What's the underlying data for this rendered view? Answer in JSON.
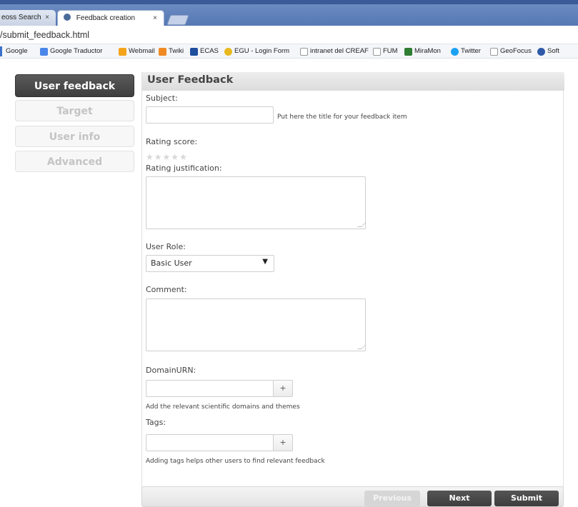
{
  "browser": {
    "tabs": [
      {
        "label": "eoss Search",
        "close": "×"
      },
      {
        "label": "Feedback creation",
        "close": "×"
      }
    ],
    "url": "/submit_feedback.html",
    "bookmarks": [
      {
        "label": "Google",
        "icon": "google-icon",
        "color": "#4285f4"
      },
      {
        "label": "Google Traductor",
        "icon": "translate-icon",
        "color": "#4a86e8"
      },
      {
        "label": "Webmail",
        "icon": "mail-icon",
        "color": "#f4a41c"
      },
      {
        "label": "Twiki",
        "icon": "twiki-icon",
        "color": "#f08a24"
      },
      {
        "label": "ECAS",
        "icon": "ecas-icon",
        "color": "#1f4e9e"
      },
      {
        "label": "EGU - Login Form",
        "icon": "egu-icon",
        "color": "#e8b820"
      },
      {
        "label": "intranet del CREAF",
        "icon": "page-icon",
        "color": "#ffffff"
      },
      {
        "label": "FUM",
        "icon": "page-icon",
        "color": "#ffffff"
      },
      {
        "label": "MiraMon",
        "icon": "miramon-icon",
        "color": "#2e7d32"
      },
      {
        "label": "Twitter",
        "icon": "twitter-icon",
        "color": "#1da1f2"
      },
      {
        "label": "GeoFocus",
        "icon": "page-icon",
        "color": "#ffffff"
      },
      {
        "label": "Soft",
        "icon": "soft-icon",
        "color": "#2e5aa8"
      }
    ]
  },
  "nav": {
    "user_feedback": "User feedback",
    "target": "Target",
    "user_info": "User info",
    "advanced": "Advanced"
  },
  "panel": {
    "title": "User Feedback",
    "subject_label": "Subject:",
    "subject_value": "",
    "subject_hint": "Put here the title for your feedback item",
    "rating_label": "Rating score:",
    "rating_value": 0,
    "rating_max": 5,
    "justification_label": "Rating justification:",
    "role_label": "User Role:",
    "role_value": "Basic User",
    "comment_label": "Comment:",
    "domain_label": "DomainURN:",
    "domain_hint": "Add the relevant scientific domains and themes",
    "tags_label": "Tags:",
    "tags_hint": "Adding tags helps other users to find relevant feedback",
    "plus": "+"
  },
  "footer": {
    "previous": "Previous",
    "next": "Next",
    "submit": "Submit"
  },
  "colors": {
    "tab_strip": "#5577b3",
    "nav_active": "#444444",
    "panel_header": "#e4e4e4"
  }
}
